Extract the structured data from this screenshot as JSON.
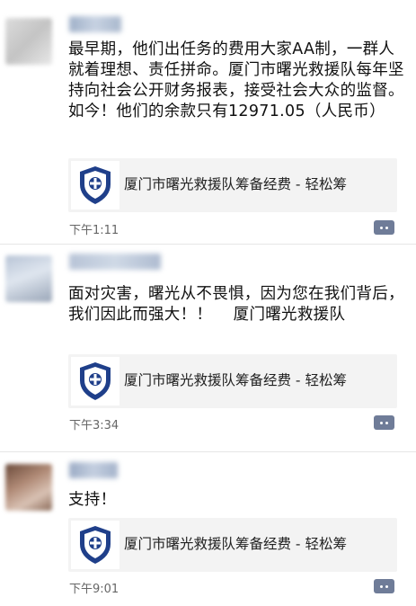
{
  "posts": [
    {
      "message": "最早期，他们出任务的费用大家AA制，一群人就着理想、责任拼命。厦门市曙光救援队每年坚持向社会公开财务报表，接受社会大众的监督。如今！他们的余款只有12971.05（人民币）",
      "card_title": "厦门市曙光救援队筹备经费 - 轻松筹",
      "time": "下午1:11"
    },
    {
      "message": "面对灾害，曙光从不畏惧，因为您在我们背后，我们因此而强大！！    厦门曙光救援队",
      "card_title": "厦门市曙光救援队筹备经费 - 轻松筹",
      "time": "下午3:34"
    },
    {
      "message": "支持！",
      "card_title": "厦门市曙光救援队筹备经费 - 轻松筹",
      "time": "下午9:01"
    }
  ],
  "colors": {
    "comment_button": "#6f7c98",
    "logo_blue": "#1f3f8a",
    "card_bg": "#f3f3f3",
    "time_text": "#666666"
  },
  "icons": {
    "logo": "rescue-team-shield-icon",
    "comment": "comment-more-icon"
  }
}
